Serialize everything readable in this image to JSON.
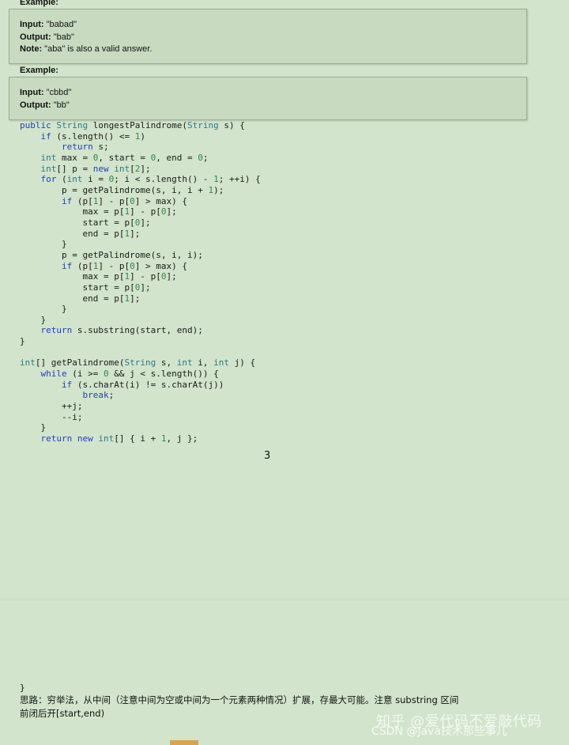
{
  "examples": [
    {
      "label": "Example:",
      "rows": [
        {
          "key": "Input:",
          "value": " \"babad\""
        },
        {
          "key": "Output:",
          "value": " \"bab\""
        },
        {
          "key": "Note:",
          "value": " \"aba\" is also a valid answer."
        }
      ]
    },
    {
      "label": "Example:",
      "rows": [
        {
          "key": "Input:",
          "value": " \"cbbd\""
        },
        {
          "key": "Output:",
          "value": " \"bb\""
        }
      ]
    }
  ],
  "code": {
    "lines": [
      "public String longestPalindrome(String s) {",
      "    if (s.length() <= 1)",
      "        return s;",
      "    int max = 0, start = 0, end = 0;",
      "    int[] p = new int[2];",
      "    for (int i = 0; i < s.length() - 1; ++i) {",
      "        p = getPalindrome(s, i, i + 1);",
      "        if (p[1] - p[0] > max) {",
      "            max = p[1] - p[0];",
      "            start = p[0];",
      "            end = p[1];",
      "        }",
      "        p = getPalindrome(s, i, i);",
      "        if (p[1] - p[0] > max) {",
      "            max = p[1] - p[0];",
      "            start = p[0];",
      "            end = p[1];",
      "        }",
      "    }",
      "    return s.substring(start, end);",
      "}",
      "",
      "int[] getPalindrome(String s, int i, int j) {",
      "    while (i >= 0 && j < s.length()) {",
      "        if (s.charAt(i) != s.charAt(j))",
      "            break;",
      "        ++j;",
      "        --i;",
      "    }",
      "    return new int[] { i + 1, j };"
    ]
  },
  "page_number": "3",
  "closing_brace": "}",
  "note_line1": "思路：穷举法，从中间（注意中间为空或中间为一个元素两种情况）扩展，存最大可能。注意 substring 区间",
  "note_line2": "前闭后开[start,end)",
  "watermark_primary": "知乎 @爱代码不爱敲代码",
  "watermark_secondary": "CSDN @Java技术那些事儿"
}
